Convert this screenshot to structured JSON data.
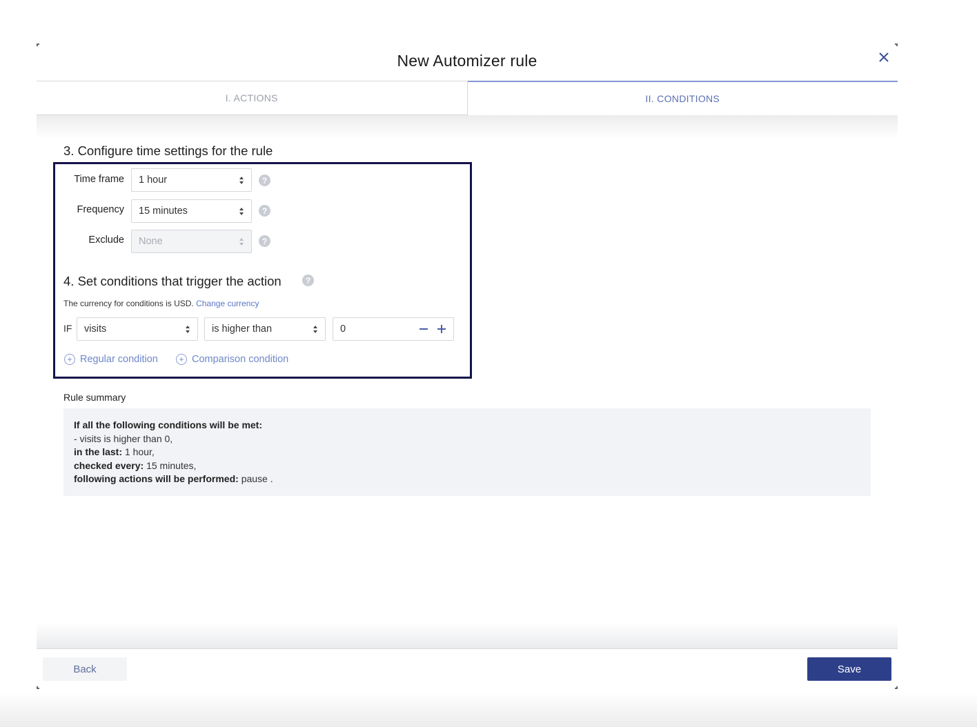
{
  "modal": {
    "title": "New Automizer rule",
    "close_icon": "close-icon"
  },
  "tabs": [
    {
      "label": "I. ACTIONS",
      "active": false
    },
    {
      "label": "II. CONDITIONS",
      "active": true
    }
  ],
  "time_settings": {
    "heading": "3. Configure time settings for the rule",
    "time_frame": {
      "label": "Time frame",
      "value": "1 hour"
    },
    "frequency": {
      "label": "Frequency",
      "value": "15 minutes"
    },
    "exclude": {
      "label": "Exclude",
      "value": "None",
      "disabled": true
    }
  },
  "conditions": {
    "heading": "4. Set conditions that trigger the action",
    "currency_note": "The currency for conditions is USD.",
    "change_currency_link": "Change currency",
    "if_label": "IF",
    "metric": "visits",
    "operator": "is higher than",
    "value": "0",
    "add_regular": "Regular condition",
    "add_comparison": "Comparison condition"
  },
  "summary": {
    "label": "Rule summary",
    "line1_bold": "If all the following conditions will be met:",
    "line2": "- visits is higher than 0,",
    "line3_bold": "in the last:",
    "line3_value": "1 hour,",
    "line4_bold": "checked every:",
    "line4_value": "15 minutes,",
    "line5_bold": "following actions will be performed:",
    "line5_value": "pause ."
  },
  "footer": {
    "back_label": "Back",
    "save_label": "Save"
  },
  "colors": {
    "accent": "#2e3f8a",
    "link": "#6f87c9",
    "highlight_border": "#14124a"
  }
}
